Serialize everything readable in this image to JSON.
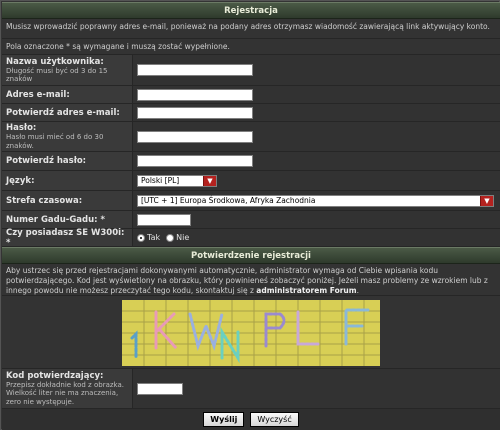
{
  "header": {
    "title": "Rejestracja"
  },
  "intro": {
    "email_note": "Musisz wprowadzić poprawny adres e-mail, ponieważ na podany adres otrzymasz wiadomość zawierającą link aktywujący konto.",
    "required_note": "Pola oznaczone * są wymagane i muszą zostać wypełnione."
  },
  "fields": {
    "username": {
      "label": "Nazwa użytkownika:",
      "hint": "Długość musi być od 3 do 15 znaków",
      "value": ""
    },
    "email": {
      "label": "Adres e-mail:",
      "value": ""
    },
    "email_confirm": {
      "label": "Potwierdź adres e-mail:",
      "value": ""
    },
    "password": {
      "label": "Hasło:",
      "hint": "Hasło musi mieć od 6 do 30 znaków.",
      "value": ""
    },
    "password_confirm": {
      "label": "Potwierdź hasło:",
      "value": ""
    },
    "language": {
      "label": "Język:",
      "selected": "Polski [PL]"
    },
    "timezone": {
      "label": "Strefa czasowa:",
      "selected": "[UTC + 1] Europa Środkowa, Afryka Zachodnia"
    },
    "gadu": {
      "label": "Numer Gadu-Gadu: *",
      "value": ""
    },
    "w300i": {
      "label": "Czy posiadasz SE W300i: *",
      "options": [
        "Tak",
        "Nie"
      ],
      "selected": "Tak"
    }
  },
  "confirmation": {
    "title": "Potwierdzenie rejestracji",
    "text": "Aby ustrzec się przed rejestracjami dokonywanymi automatycznie, administrator wymaga od Ciebie wpisania kodu potwierdzającego. Kod jest wyświetlony na obrazku, który powinieneś zobaczyć poniżej. Jeżeli masz problemy ze wzrokiem lub z innego powodu nie możesz przeczytać tego kodu, skontaktuj się z ",
    "admin_link": "administratorem Forum",
    "text_end": ".",
    "captcha_text": "1KWNPLF",
    "code_label": "Kod potwierdzający:",
    "code_hint": "Przepisz dokładnie kod z obrazka. Wielkość liter nie ma znaczenia, zero nie występuje.",
    "code_value": ""
  },
  "buttons": {
    "submit": "Wyślij",
    "reset": "Wyczyść"
  },
  "colors": {
    "header_green": "#3e4b3a",
    "dropdown_red": "#b4221f",
    "row_bg": "#3a3a3a"
  },
  "icons": {
    "dropdown": "triangle-down-icon"
  }
}
